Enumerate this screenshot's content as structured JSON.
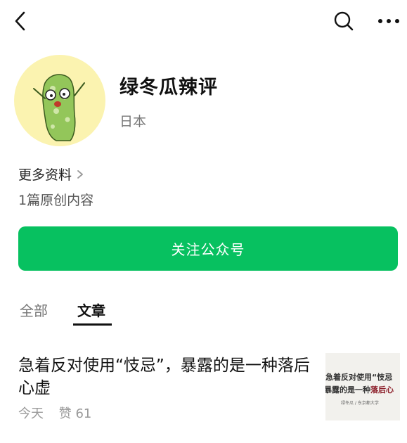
{
  "topbar": {
    "back": "back-icon",
    "search": "search-icon",
    "more": "more-icon"
  },
  "profile": {
    "name": "绿冬瓜辣评",
    "region": "日本",
    "more_info_label": "更多资料",
    "original_count_label": "1篇原创内容",
    "follow_label": "关注公众号"
  },
  "tabs": [
    {
      "label": "全部",
      "active": false
    },
    {
      "label": "文章",
      "active": true
    }
  ],
  "articles": [
    {
      "title": "急着反对使用“忮忌”，暴露的是一种落后心虚",
      "date": "今天",
      "likes": "赞 61",
      "thumbnail": {
        "line1": "急着反对使用“忮忌",
        "line2_a": "暴露的是一种",
        "line2_b": "落后心",
        "footer": "绿冬瓜 / 东京都大学"
      }
    }
  ],
  "colors": {
    "accent": "#07c160",
    "avatar_bg": "#fbf3b0",
    "thumb_highlight": "#8c1f2a"
  }
}
